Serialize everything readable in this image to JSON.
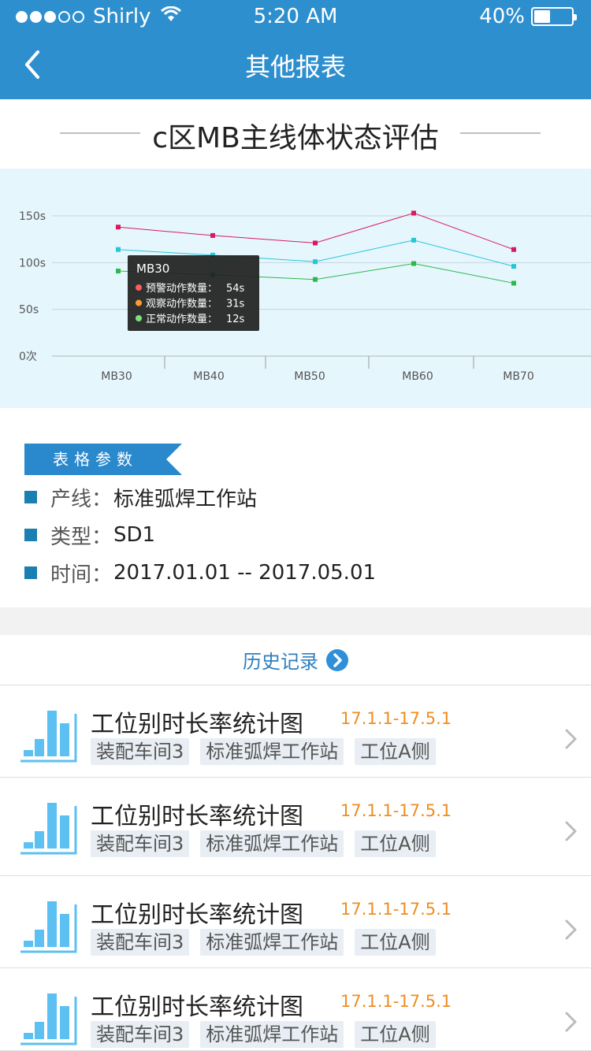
{
  "status_bar": {
    "carrier": "Shirly",
    "time": "5:20 AM",
    "battery": "40%",
    "battery_level": 0.4
  },
  "nav": {
    "title": "其他报表",
    "back_icon": "chevron-left-icon"
  },
  "report": {
    "title": "c区MB主线体状态评估"
  },
  "chart_data": {
    "type": "line",
    "categories": [
      "MB30",
      "MB40",
      "MB50",
      "MB60",
      "MB70"
    ],
    "y_ticks": [
      "150s",
      "100s",
      "50s",
      "0次"
    ],
    "ylim": [
      0,
      150
    ],
    "grid": true,
    "series": [
      {
        "values": [
          138,
          129,
          121,
          153,
          114
        ],
        "color": "#d81b60"
      },
      {
        "values": [
          114,
          108,
          101,
          124,
          96
        ],
        "color": "#26c6da"
      },
      {
        "values": [
          91,
          87,
          82,
          99,
          78
        ],
        "color": "#2db84d"
      }
    ],
    "tooltip": {
      "title": "MB30",
      "rows": [
        {
          "label": "预警动作数量：",
          "value": "54s",
          "color": "#ff5b5b"
        },
        {
          "label": "观察动作数量：",
          "value": "31s",
          "color": "#ff9a2e"
        },
        {
          "label": "正常动作数量：",
          "value": "12s",
          "color": "#7be37b"
        }
      ]
    }
  },
  "params": {
    "header": "表格参数",
    "rows": [
      {
        "label": "产线：",
        "value": "标准弧焊工作站"
      },
      {
        "label": "类型：",
        "value": "SD1"
      },
      {
        "label": "时间：",
        "value": "2017.01.01 -- 2017.05.01"
      }
    ]
  },
  "history": {
    "label": "历史记录",
    "icon": "chevron-right-circle-icon"
  },
  "records": [
    {
      "title": "工位别时长率统计图",
      "date": "17.1.1-17.5.1",
      "tags": [
        "装配车间3",
        "标准弧焊工作站",
        "工位A侧"
      ]
    },
    {
      "title": "工位别时长率统计图",
      "date": "17.1.1-17.5.1",
      "tags": [
        "装配车间3",
        "标准弧焊工作站",
        "工位A侧"
      ]
    },
    {
      "title": "工位别时长率统计图",
      "date": "17.1.1-17.5.1",
      "tags": [
        "装配车间3",
        "标准弧焊工作站",
        "工位A侧"
      ]
    },
    {
      "title": "工位别时长率统计图",
      "date": "17.1.1-17.5.1",
      "tags": [
        "装配车间3",
        "标准弧焊工作站",
        "工位A侧"
      ]
    }
  ],
  "colors": {
    "header_bg": "#2e8fcf",
    "accent": "#2a88cc",
    "date_orange": "#f08c1e",
    "chart_bg": "#e6f6fd"
  }
}
